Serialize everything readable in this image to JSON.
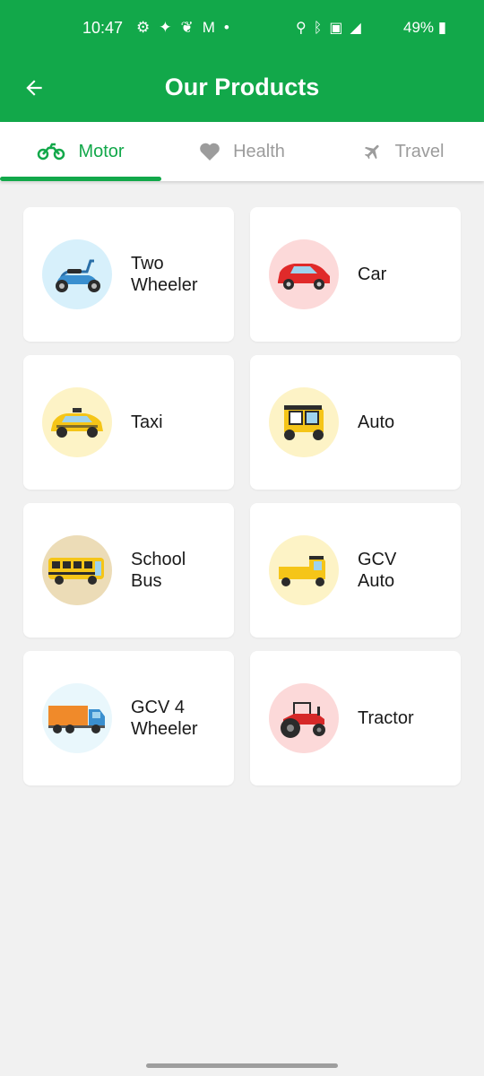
{
  "status": {
    "time": "10:47",
    "battery": "49%",
    "icons": [
      "gear-icon",
      "twitter-icon",
      "leaf-icon",
      "gmail-icon",
      "dot-icon",
      "location-icon",
      "bluetooth-icon",
      "volte-icon",
      "signal-4g-icon",
      "battery-icon"
    ]
  },
  "app_bar": {
    "title": "Our Products",
    "back_icon": "arrow-left-icon"
  },
  "tabs": [
    {
      "label": "Motor",
      "icon": "motorcycle-icon",
      "active": true
    },
    {
      "label": "Health",
      "icon": "heart-icon",
      "active": false
    },
    {
      "label": "Travel",
      "icon": "airplane-icon",
      "active": false
    }
  ],
  "products": [
    {
      "label": "Two Wheeler",
      "icon": "scooter-icon",
      "circle_color": "#d7f0fb"
    },
    {
      "label": "Car",
      "icon": "car-icon",
      "circle_color": "#fcd9d9"
    },
    {
      "label": "Taxi",
      "icon": "taxi-icon",
      "circle_color": "#fdf3c6"
    },
    {
      "label": "Auto",
      "icon": "auto-rickshaw-icon",
      "circle_color": "#fdf3c6"
    },
    {
      "label": "School Bus",
      "icon": "school-bus-icon",
      "circle_color": "#ecdcb7"
    },
    {
      "label": "GCV Auto",
      "icon": "goods-auto-icon",
      "circle_color": "#fdf3c6"
    },
    {
      "label": "GCV 4 Wheeler",
      "icon": "truck-icon",
      "circle_color": "#e9f7fc"
    },
    {
      "label": "Tractor",
      "icon": "tractor-icon",
      "circle_color": "#fcd9d9"
    }
  ],
  "colors": {
    "primary": "#12a84a",
    "background": "#f1f1f1",
    "inactive_tab": "#9c9c9c"
  }
}
